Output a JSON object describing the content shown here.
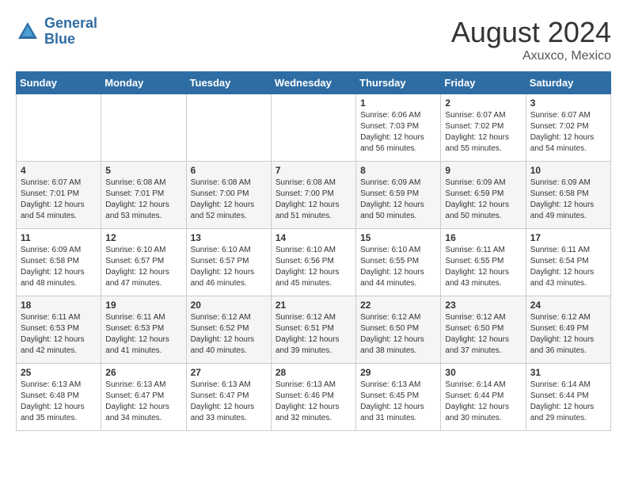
{
  "header": {
    "logo_line1": "General",
    "logo_line2": "Blue",
    "month_year": "August 2024",
    "location": "Axuxco, Mexico"
  },
  "days_of_week": [
    "Sunday",
    "Monday",
    "Tuesday",
    "Wednesday",
    "Thursday",
    "Friday",
    "Saturday"
  ],
  "weeks": [
    [
      {
        "day": "",
        "info": ""
      },
      {
        "day": "",
        "info": ""
      },
      {
        "day": "",
        "info": ""
      },
      {
        "day": "",
        "info": ""
      },
      {
        "day": "1",
        "info": "Sunrise: 6:06 AM\nSunset: 7:03 PM\nDaylight: 12 hours\nand 56 minutes."
      },
      {
        "day": "2",
        "info": "Sunrise: 6:07 AM\nSunset: 7:02 PM\nDaylight: 12 hours\nand 55 minutes."
      },
      {
        "day": "3",
        "info": "Sunrise: 6:07 AM\nSunset: 7:02 PM\nDaylight: 12 hours\nand 54 minutes."
      }
    ],
    [
      {
        "day": "4",
        "info": "Sunrise: 6:07 AM\nSunset: 7:01 PM\nDaylight: 12 hours\nand 54 minutes."
      },
      {
        "day": "5",
        "info": "Sunrise: 6:08 AM\nSunset: 7:01 PM\nDaylight: 12 hours\nand 53 minutes."
      },
      {
        "day": "6",
        "info": "Sunrise: 6:08 AM\nSunset: 7:00 PM\nDaylight: 12 hours\nand 52 minutes."
      },
      {
        "day": "7",
        "info": "Sunrise: 6:08 AM\nSunset: 7:00 PM\nDaylight: 12 hours\nand 51 minutes."
      },
      {
        "day": "8",
        "info": "Sunrise: 6:09 AM\nSunset: 6:59 PM\nDaylight: 12 hours\nand 50 minutes."
      },
      {
        "day": "9",
        "info": "Sunrise: 6:09 AM\nSunset: 6:59 PM\nDaylight: 12 hours\nand 50 minutes."
      },
      {
        "day": "10",
        "info": "Sunrise: 6:09 AM\nSunset: 6:58 PM\nDaylight: 12 hours\nand 49 minutes."
      }
    ],
    [
      {
        "day": "11",
        "info": "Sunrise: 6:09 AM\nSunset: 6:58 PM\nDaylight: 12 hours\nand 48 minutes."
      },
      {
        "day": "12",
        "info": "Sunrise: 6:10 AM\nSunset: 6:57 PM\nDaylight: 12 hours\nand 47 minutes."
      },
      {
        "day": "13",
        "info": "Sunrise: 6:10 AM\nSunset: 6:57 PM\nDaylight: 12 hours\nand 46 minutes."
      },
      {
        "day": "14",
        "info": "Sunrise: 6:10 AM\nSunset: 6:56 PM\nDaylight: 12 hours\nand 45 minutes."
      },
      {
        "day": "15",
        "info": "Sunrise: 6:10 AM\nSunset: 6:55 PM\nDaylight: 12 hours\nand 44 minutes."
      },
      {
        "day": "16",
        "info": "Sunrise: 6:11 AM\nSunset: 6:55 PM\nDaylight: 12 hours\nand 43 minutes."
      },
      {
        "day": "17",
        "info": "Sunrise: 6:11 AM\nSunset: 6:54 PM\nDaylight: 12 hours\nand 43 minutes."
      }
    ],
    [
      {
        "day": "18",
        "info": "Sunrise: 6:11 AM\nSunset: 6:53 PM\nDaylight: 12 hours\nand 42 minutes."
      },
      {
        "day": "19",
        "info": "Sunrise: 6:11 AM\nSunset: 6:53 PM\nDaylight: 12 hours\nand 41 minutes."
      },
      {
        "day": "20",
        "info": "Sunrise: 6:12 AM\nSunset: 6:52 PM\nDaylight: 12 hours\nand 40 minutes."
      },
      {
        "day": "21",
        "info": "Sunrise: 6:12 AM\nSunset: 6:51 PM\nDaylight: 12 hours\nand 39 minutes."
      },
      {
        "day": "22",
        "info": "Sunrise: 6:12 AM\nSunset: 6:50 PM\nDaylight: 12 hours\nand 38 minutes."
      },
      {
        "day": "23",
        "info": "Sunrise: 6:12 AM\nSunset: 6:50 PM\nDaylight: 12 hours\nand 37 minutes."
      },
      {
        "day": "24",
        "info": "Sunrise: 6:12 AM\nSunset: 6:49 PM\nDaylight: 12 hours\nand 36 minutes."
      }
    ],
    [
      {
        "day": "25",
        "info": "Sunrise: 6:13 AM\nSunset: 6:48 PM\nDaylight: 12 hours\nand 35 minutes."
      },
      {
        "day": "26",
        "info": "Sunrise: 6:13 AM\nSunset: 6:47 PM\nDaylight: 12 hours\nand 34 minutes."
      },
      {
        "day": "27",
        "info": "Sunrise: 6:13 AM\nSunset: 6:47 PM\nDaylight: 12 hours\nand 33 minutes."
      },
      {
        "day": "28",
        "info": "Sunrise: 6:13 AM\nSunset: 6:46 PM\nDaylight: 12 hours\nand 32 minutes."
      },
      {
        "day": "29",
        "info": "Sunrise: 6:13 AM\nSunset: 6:45 PM\nDaylight: 12 hours\nand 31 minutes."
      },
      {
        "day": "30",
        "info": "Sunrise: 6:14 AM\nSunset: 6:44 PM\nDaylight: 12 hours\nand 30 minutes."
      },
      {
        "day": "31",
        "info": "Sunrise: 6:14 AM\nSunset: 6:44 PM\nDaylight: 12 hours\nand 29 minutes."
      }
    ]
  ]
}
